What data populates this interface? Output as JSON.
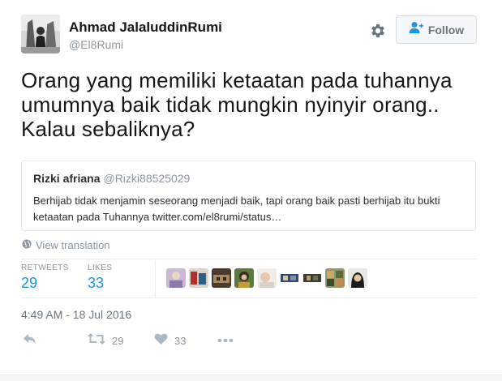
{
  "author": {
    "name": "Ahmad JalaluddinRumi",
    "handle": "@El8Rumi"
  },
  "header": {
    "settings_icon": "gear-icon",
    "follow_label": "Follow",
    "follow_icon": "add-user-icon"
  },
  "tweet": {
    "text": "Orang yang memiliki ketaatan pada tuhannya umumnya baik tidak mungkin nyinyir orang.. Kalau sebaliknya?",
    "translate_label": "View translation",
    "timestamp": "4:49 AM - 18 Jul 2016"
  },
  "quoted_tweet": {
    "name": "Rizki afriana",
    "handle": "@Rizki88525029",
    "text": "Berhijab tidak menjamin seseorang menjadi baik, tapi orang baik pasti berhijab itu bukti ketaatan pada Tuhannya twitter.com/el8rumi/status…"
  },
  "stats": {
    "retweets_label": "RETWEETS",
    "retweets_value": "29",
    "likes_label": "LIKES",
    "likes_value": "33"
  },
  "likers_count": 9,
  "actions": {
    "reply_icon": "reply-icon",
    "retweet_icon": "retweet-icon",
    "retweet_count": "29",
    "like_icon": "heart-icon",
    "like_count": "33",
    "more_icon": "more-icon"
  },
  "colors": {
    "accent": "#1b95e0",
    "muted": "#8a96a1",
    "text": "#14171a"
  }
}
